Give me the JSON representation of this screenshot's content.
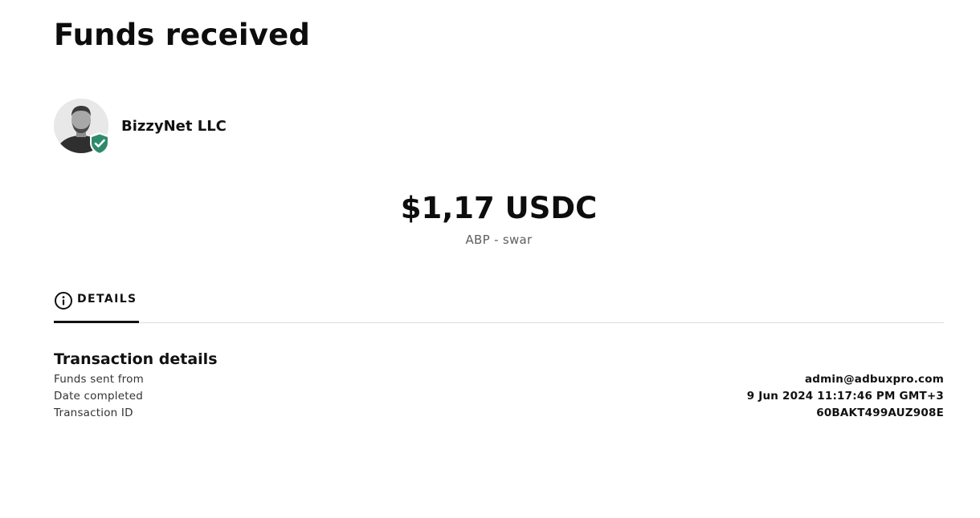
{
  "page": {
    "title": "Funds received"
  },
  "sender": {
    "name": "BizzyNet LLC",
    "avatar_icon": "user-photo",
    "verified_icon": "shield-check-icon",
    "verified_color": "#2e8b6a"
  },
  "amount": {
    "value": "$1,17 USDC",
    "memo": "ABP - swar"
  },
  "tabs": [
    {
      "label": "DETAILS",
      "icon": "info-icon",
      "active": true
    }
  ],
  "details": {
    "heading": "Transaction details",
    "rows": [
      {
        "label": "Funds sent from",
        "value": "admin@adbuxpro.com"
      },
      {
        "label": "Date completed",
        "value": "9 Jun 2024 11:17:46 PM GMT+3"
      },
      {
        "label": "Transaction ID",
        "value": "60BAKT499AUZ908E"
      }
    ]
  }
}
